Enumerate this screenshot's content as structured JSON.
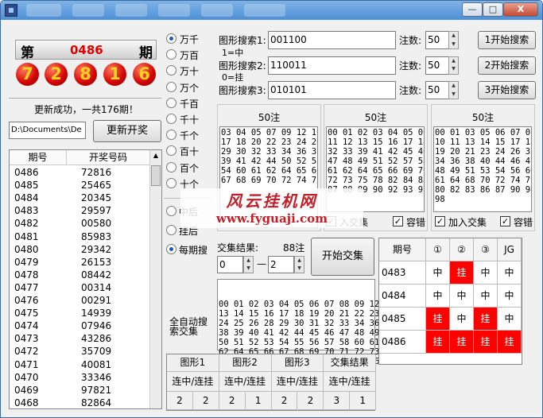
{
  "window": {
    "minimize": "—",
    "maximize": "□",
    "close": "X"
  },
  "header": {
    "left_char": "第",
    "period": "0486",
    "right_char": "期"
  },
  "balls": [
    "7",
    "2",
    "8",
    "1",
    "6"
  ],
  "status": "更新成功，一共176期！",
  "path_value": "D:\\Documents\\De",
  "update_button": "更新开奖",
  "list": {
    "col1": "期号",
    "col2": "开奖号码",
    "rows": [
      [
        "0486",
        "72816"
      ],
      [
        "0485",
        "25465"
      ],
      [
        "0484",
        "20345"
      ],
      [
        "0483",
        "29597"
      ],
      [
        "0482",
        "00580"
      ],
      [
        "0481",
        "85983"
      ],
      [
        "0480",
        "29342"
      ],
      [
        "0479",
        "26153"
      ],
      [
        "0478",
        "08442"
      ],
      [
        "0477",
        "00314"
      ],
      [
        "0476",
        "00291"
      ],
      [
        "0475",
        "14939"
      ],
      [
        "0474",
        "07946"
      ],
      [
        "0473",
        "43286"
      ],
      [
        "0472",
        "35709"
      ],
      [
        "0471",
        "40081"
      ],
      [
        "0470",
        "33346"
      ],
      [
        "0469",
        "97821"
      ],
      [
        "0468",
        "82864"
      ]
    ]
  },
  "positions": [
    "万千",
    "万百",
    "万十",
    "万个",
    "千百",
    "千十",
    "千个",
    "百十",
    "百个",
    "十个"
  ],
  "modes": [
    "中后",
    "挂后",
    "每期搜"
  ],
  "search": {
    "rows": [
      {
        "label": "图形搜索1:",
        "value": "001100",
        "count_label": "注数:",
        "count": "50",
        "button": "1开始搜索"
      },
      {
        "label": "图形搜索2:",
        "value": "110011",
        "count_label": "注数:",
        "count": "50",
        "button": "2开始搜索"
      },
      {
        "label": "图形搜索3:",
        "value": "010101",
        "count_label": "注数:",
        "count": "50",
        "button": "3开始搜索"
      }
    ],
    "note1": "1=中",
    "note2": "0=挂"
  },
  "panels": [
    {
      "title": "50注",
      "lines": [
        "03 04 05 07 09 12 16",
        "17 18 20 22 23 24 26",
        "29 30 32 33 34 36 38",
        "39 41 42 44 50 52 53",
        "54 60 61 62 64 65 66",
        "67 68 69 70 72 74 75"
      ],
      "checks": []
    },
    {
      "title": "50注",
      "lines": [
        "00 01 02 03 04 05 06",
        "11 12 13 15 16 17 18",
        "32 33 39 41 42 45 46",
        "47 48 49 51 52 57 58",
        "61 62 64 65 66 69 70",
        "72 73 75 78 82 84 85",
        "87 88 89 90 92 93 97"
      ],
      "checks": [
        {
          "label": "入交集",
          "checked": true
        },
        {
          "label": "容错",
          "checked": true
        }
      ]
    },
    {
      "title": "50注",
      "lines": [
        "00 01 03 05 06 07 08",
        "10 11 13 14 15 17 18",
        "19 20 21 23 24 26 31",
        "34 36 38 40 44 46 47",
        "48 49 51 53 54 56 60",
        "61 64 68 70 72 74 79",
        "80 82 83 86 87 90 94",
        "98"
      ],
      "checks": [
        {
          "label": "加入交集",
          "checked": true
        },
        {
          "label": "容错",
          "checked": true
        }
      ]
    }
  ],
  "watermark": {
    "title": "风云挂机网",
    "url": "www.fyguaji.com"
  },
  "intersect": {
    "label": "交集结果:",
    "count": "88注",
    "from": "0",
    "dash": "—",
    "to": "2",
    "button": "开始交集",
    "lines": [
      "00 01 02 03 04 05 06 07 08 09 12",
      "13 14 15 16 17 18 19 20 21 22 23",
      "24 25 26 28 29 30 31 32 33 34 36",
      "38 39 40 41 42 44 45 46 47 48 49",
      "50 51 52 53 54 55 56 57 58 60 61",
      "62 64 65 66 67 68 69 70 71 72 73",
      "74 75 77 78 79 80 82 83 84 85 86"
    ]
  },
  "auto_label": "全自动搜索交集",
  "summary": {
    "headers": [
      "图形1",
      "图形2",
      "图形3",
      "交集结果"
    ],
    "sub": [
      "连中/连挂",
      "连中/连挂",
      "连中/连挂",
      "连中/连挂"
    ],
    "values": [
      "2",
      "2",
      "2",
      "1",
      "2",
      "2",
      "3",
      "1"
    ]
  },
  "result": {
    "headers": [
      "期号",
      "①",
      "②",
      "③",
      "JG"
    ],
    "rows": [
      {
        "period": "0483",
        "cells": [
          "中",
          "挂",
          "中",
          "中"
        ],
        "red": [
          false,
          true,
          false,
          false
        ]
      },
      {
        "period": "0484",
        "cells": [
          "中",
          "中",
          "中",
          "中"
        ],
        "red": [
          false,
          false,
          false,
          false
        ]
      },
      {
        "period": "0485",
        "cells": [
          "挂",
          "中",
          "挂",
          "中"
        ],
        "red": [
          true,
          false,
          true,
          false
        ]
      },
      {
        "period": "0486",
        "cells": [
          "挂",
          "挂",
          "挂",
          "挂"
        ],
        "red": [
          true,
          true,
          true,
          true
        ]
      }
    ],
    "red_color": "#ff0000"
  }
}
